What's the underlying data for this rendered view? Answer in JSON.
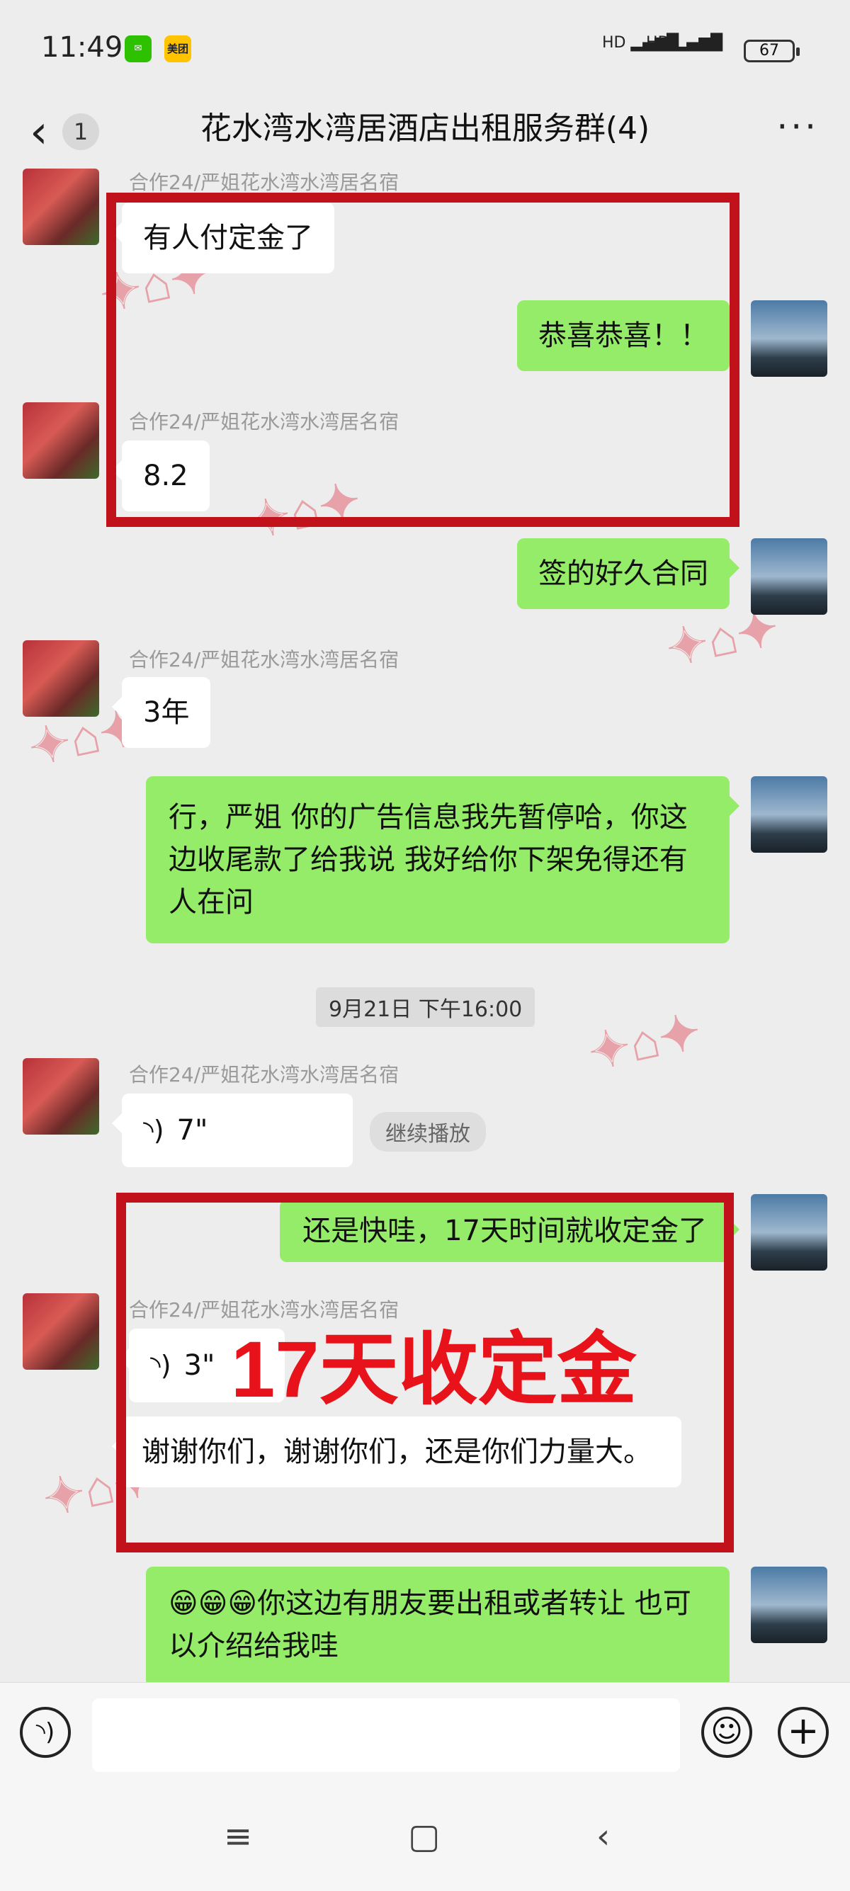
{
  "status_bar": {
    "time": "11:49",
    "app_icons": [
      "wechat-icon",
      "meituan-icon"
    ],
    "meituan_label": "美团",
    "network_left": "HD",
    "network_right": "HD",
    "battery": "67"
  },
  "header": {
    "unread_count": "1",
    "title": "花水湾水湾居酒店出租服务群(4)",
    "more": "···"
  },
  "messages": {
    "sender_name": "合作24/严姐花水湾水湾居名宿",
    "m1": "有人付定金了",
    "m2": "恭喜恭喜！！",
    "m3": "8.2",
    "m4": "签的好久合同",
    "m5": "3年",
    "m6": "行，严姐  你的广告信息我先暂停哈，你这边收尾款了给我说  我好给你下架免得还有人在问",
    "timestamp": "9月21日 下午16:00",
    "voice1_duration": "7\"",
    "resume_label": "继续播放",
    "m8": "还是快哇，17天时间就收定金了",
    "voice2_duration": "3\"",
    "m10": "谢谢你们，谢谢你们，还是你们力量大。",
    "m11": "😁😁😁你这边有朋友要出租或者转让 也可以介绍给我哇"
  },
  "overlay": {
    "big_label": "17天收定金",
    "highlight_color": "#c1121b"
  },
  "input_bar": {
    "placeholder": ""
  },
  "colors": {
    "bubble_green": "#95ec69",
    "bubble_white": "#ffffff",
    "background": "#ededed"
  }
}
